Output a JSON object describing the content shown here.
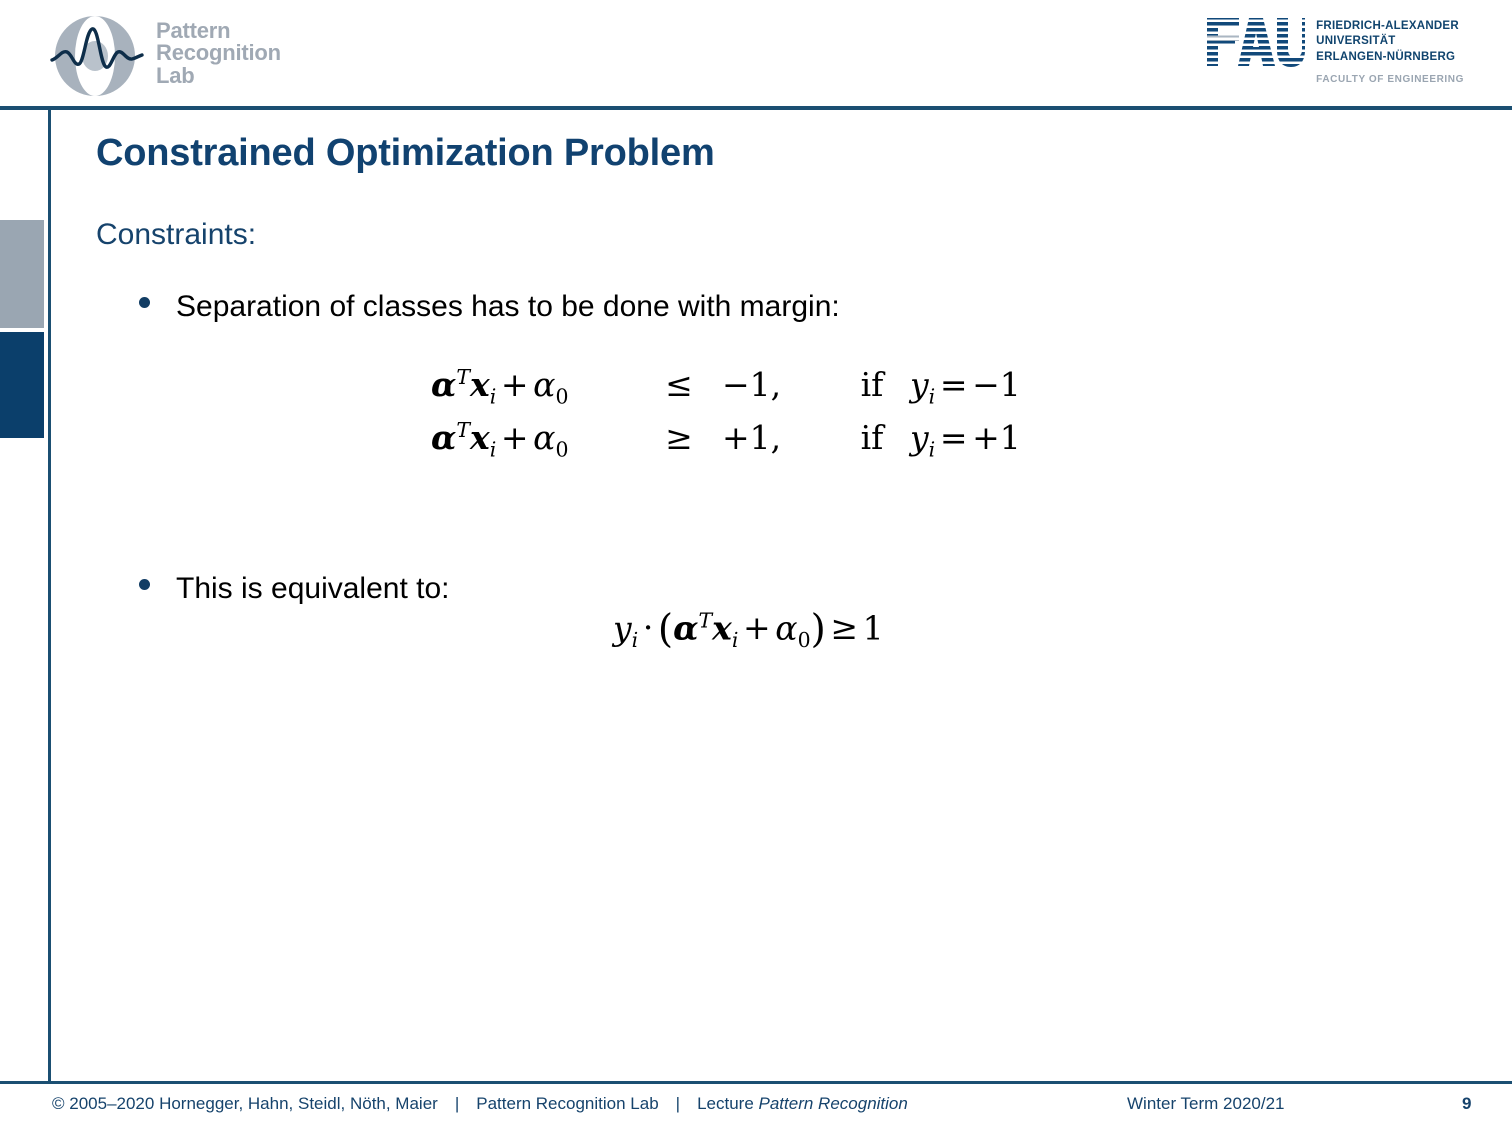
{
  "header": {
    "prl_logo": {
      "icon": "waveform-globe-logo",
      "line1": "Pattern",
      "line2": "Recognition",
      "line3": "Lab"
    },
    "fau_logo": {
      "icon": "fau-striped-logo",
      "name_line1": "FRIEDRICH-ALEXANDER",
      "name_line2": "UNIVERSITÄT",
      "name_line3": "ERLANGEN-NÜRNBERG",
      "faculty": "FACULTY OF ENGINEERING"
    }
  },
  "slide": {
    "title": "Constrained Optimization Problem",
    "section_label": "Constraints:",
    "bullets": [
      {
        "text": "Separation of classes has to be done with margin:"
      },
      {
        "text": "This is equivalent to:"
      }
    ],
    "equation_block_1": {
      "rows": [
        {
          "lhs": "αᵀxᵢ + α₀",
          "relation": "≤",
          "rhs": "−1,",
          "if": "if",
          "condition": "yᵢ = −1"
        },
        {
          "lhs": "αᵀxᵢ + α₀",
          "relation": "≥",
          "rhs": "+1,",
          "if": "if",
          "condition": "yᵢ = +1"
        }
      ]
    },
    "equation_block_2": {
      "expression": "yᵢ · (αᵀxᵢ + α₀) ≥ 1"
    }
  },
  "nav_markers": [
    {
      "name": "progress-marker-gray",
      "color": "#9aa6b2"
    },
    {
      "name": "progress-marker-navy",
      "color": "#0b3f6b"
    }
  ],
  "footer": {
    "copyright": "© 2005–2020 Hornegger, Hahn, Steidl, Nöth, Maier",
    "separator": "|",
    "lab": "Pattern Recognition Lab",
    "lecture_prefix": "Lecture",
    "lecture_name": "Pattern Recognition",
    "term": "Winter Term 2020/21",
    "page_number": "9"
  },
  "colors": {
    "brand_navy": "#114270",
    "frame_navy": "#1b4f72",
    "logo_gray": "#a0a9b4",
    "marker_gray": "#9aa6b2",
    "marker_navy": "#0b3f6b"
  }
}
